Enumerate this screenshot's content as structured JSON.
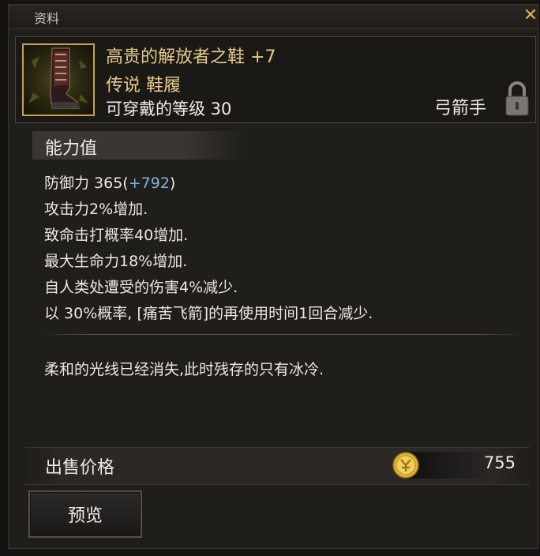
{
  "window": {
    "title": "资料"
  },
  "item": {
    "name": "高贵的解放者之鞋",
    "enhance": "+7",
    "grade": "传说 鞋履",
    "level_label": "可穿戴的等级 30",
    "class": "弓箭手",
    "icon": "boot-icon",
    "lock_icon": "lock-icon"
  },
  "abilities": {
    "title": "能力值",
    "defense_label": "防御力 365(",
    "defense_bonus": "+792",
    "defense_close": ")",
    "lines": [
      "攻击力2%增加.",
      "致命击打概率40增加.",
      "最大生命力18%增加.",
      "自人类处遭受的伤害4%减少.",
      "以 30%概率, [痛苦飞箭]的再使用时间1回合减少."
    ]
  },
  "flavor_text": "柔和的光线已经消失,此时残存的只有冰冷.",
  "price": {
    "label": "出售价格",
    "value": "755",
    "icon": "gold-coin-icon"
  },
  "buttons": {
    "preview": "预览"
  },
  "colors": {
    "gold": "#e6c98a",
    "bonus_blue": "#7fb2df",
    "frame_gold": "#c7a14a"
  }
}
